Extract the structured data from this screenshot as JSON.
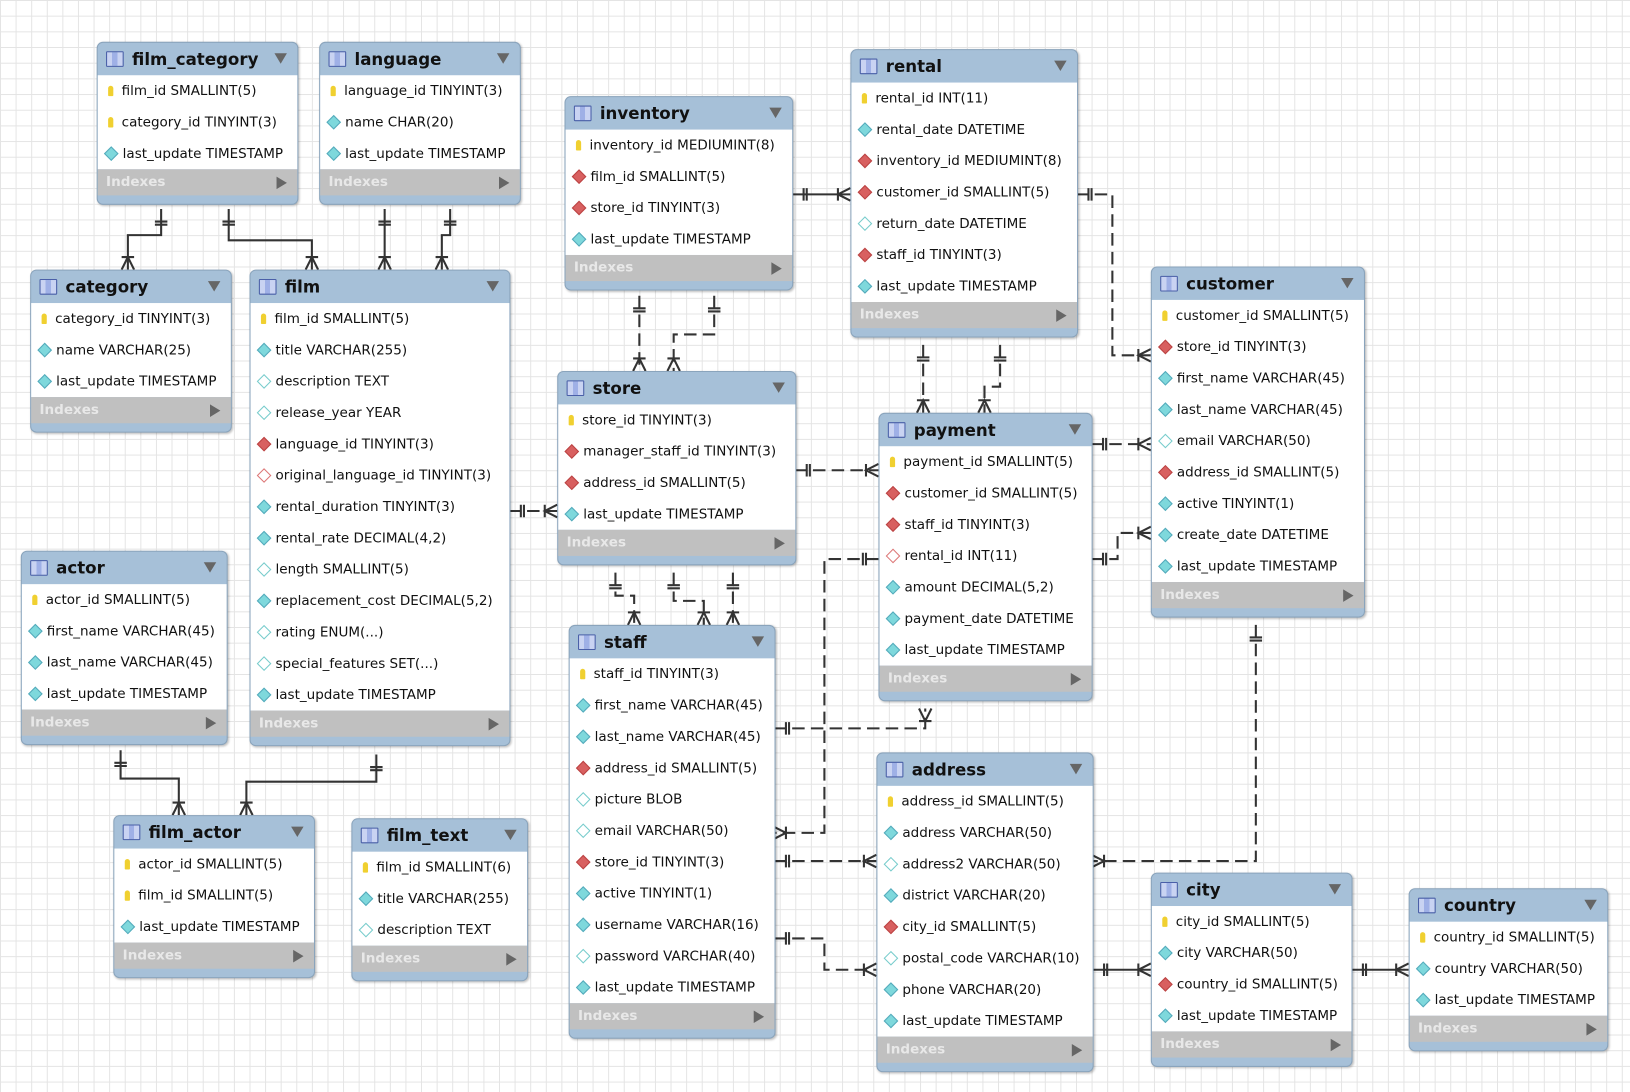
{
  "indexes_label": "Indexes",
  "colors": {
    "header": "#a6c0d8",
    "indexes": "#c0c0c0",
    "pk": "#f0d030",
    "not_null": "#7ed8dc",
    "foreign_key": "#d86060"
  },
  "tables": [
    {
      "name": "film_category",
      "columns": [
        [
          "film_id SMALLINT(5)",
          "pk"
        ],
        [
          "category_id TINYINT(3)",
          "pk"
        ],
        [
          "last_update TIMESTAMP",
          "nn"
        ]
      ]
    },
    {
      "name": "language",
      "columns": [
        [
          "language_id TINYINT(3)",
          "pk"
        ],
        [
          "name CHAR(20)",
          "nn"
        ],
        [
          "last_update TIMESTAMP",
          "nn"
        ]
      ]
    },
    {
      "name": "inventory",
      "columns": [
        [
          "inventory_id MEDIUMINT(8)",
          "pk"
        ],
        [
          "film_id SMALLINT(5)",
          "fk"
        ],
        [
          "store_id TINYINT(3)",
          "fk"
        ],
        [
          "last_update TIMESTAMP",
          "nn"
        ]
      ]
    },
    {
      "name": "rental",
      "columns": [
        [
          "rental_id INT(11)",
          "pk"
        ],
        [
          "rental_date DATETIME",
          "nn"
        ],
        [
          "inventory_id MEDIUMINT(8)",
          "fk"
        ],
        [
          "customer_id SMALLINT(5)",
          "fk"
        ],
        [
          "return_date DATETIME",
          "null"
        ],
        [
          "staff_id TINYINT(3)",
          "fk"
        ],
        [
          "last_update TIMESTAMP",
          "nn"
        ]
      ]
    },
    {
      "name": "category",
      "columns": [
        [
          "category_id TINYINT(3)",
          "pk"
        ],
        [
          "name VARCHAR(25)",
          "nn"
        ],
        [
          "last_update TIMESTAMP",
          "nn"
        ]
      ]
    },
    {
      "name": "film",
      "columns": [
        [
          "film_id SMALLINT(5)",
          "pk"
        ],
        [
          "title VARCHAR(255)",
          "nn"
        ],
        [
          "description TEXT",
          "null"
        ],
        [
          "release_year YEAR",
          "null"
        ],
        [
          "language_id TINYINT(3)",
          "fk"
        ],
        [
          "original_language_id TINYINT(3)",
          "fknull"
        ],
        [
          "rental_duration TINYINT(3)",
          "nn"
        ],
        [
          "rental_rate DECIMAL(4,2)",
          "nn"
        ],
        [
          "length SMALLINT(5)",
          "null"
        ],
        [
          "replacement_cost DECIMAL(5,2)",
          "nn"
        ],
        [
          "rating ENUM(...)",
          "null"
        ],
        [
          "special_features SET(...)",
          "null"
        ],
        [
          "last_update TIMESTAMP",
          "nn"
        ]
      ]
    },
    {
      "name": "store",
      "columns": [
        [
          "store_id TINYINT(3)",
          "pk"
        ],
        [
          "manager_staff_id TINYINT(3)",
          "fk"
        ],
        [
          "address_id SMALLINT(5)",
          "fk"
        ],
        [
          "last_update TIMESTAMP",
          "nn"
        ]
      ]
    },
    {
      "name": "customer",
      "columns": [
        [
          "customer_id SMALLINT(5)",
          "pk"
        ],
        [
          "store_id TINYINT(3)",
          "fk"
        ],
        [
          "first_name VARCHAR(45)",
          "nn"
        ],
        [
          "last_name VARCHAR(45)",
          "nn"
        ],
        [
          "email VARCHAR(50)",
          "null"
        ],
        [
          "address_id SMALLINT(5)",
          "fk"
        ],
        [
          "active TINYINT(1)",
          "nn"
        ],
        [
          "create_date DATETIME",
          "nn"
        ],
        [
          "last_update TIMESTAMP",
          "nn"
        ]
      ]
    },
    {
      "name": "payment",
      "columns": [
        [
          "payment_id SMALLINT(5)",
          "pk"
        ],
        [
          "customer_id SMALLINT(5)",
          "fk"
        ],
        [
          "staff_id TINYINT(3)",
          "fk"
        ],
        [
          "rental_id INT(11)",
          "fknull"
        ],
        [
          "amount DECIMAL(5,2)",
          "nn"
        ],
        [
          "payment_date DATETIME",
          "nn"
        ],
        [
          "last_update TIMESTAMP",
          "nn"
        ]
      ]
    },
    {
      "name": "actor",
      "columns": [
        [
          "actor_id SMALLINT(5)",
          "pk"
        ],
        [
          "first_name VARCHAR(45)",
          "nn"
        ],
        [
          "last_name VARCHAR(45)",
          "nn"
        ],
        [
          "last_update TIMESTAMP",
          "nn"
        ]
      ]
    },
    {
      "name": "staff",
      "columns": [
        [
          "staff_id TINYINT(3)",
          "pk"
        ],
        [
          "first_name VARCHAR(45)",
          "nn"
        ],
        [
          "last_name VARCHAR(45)",
          "nn"
        ],
        [
          "address_id SMALLINT(5)",
          "fk"
        ],
        [
          "picture BLOB",
          "null"
        ],
        [
          "email VARCHAR(50)",
          "null"
        ],
        [
          "store_id TINYINT(3)",
          "fk"
        ],
        [
          "active TINYINT(1)",
          "nn"
        ],
        [
          "username VARCHAR(16)",
          "nn"
        ],
        [
          "password VARCHAR(40)",
          "null"
        ],
        [
          "last_update TIMESTAMP",
          "nn"
        ]
      ]
    },
    {
      "name": "address",
      "columns": [
        [
          "address_id SMALLINT(5)",
          "pk"
        ],
        [
          "address VARCHAR(50)",
          "nn"
        ],
        [
          "address2 VARCHAR(50)",
          "null"
        ],
        [
          "district VARCHAR(20)",
          "nn"
        ],
        [
          "city_id SMALLINT(5)",
          "fk"
        ],
        [
          "postal_code VARCHAR(10)",
          "null"
        ],
        [
          "phone VARCHAR(20)",
          "nn"
        ],
        [
          "last_update TIMESTAMP",
          "nn"
        ]
      ]
    },
    {
      "name": "film_actor",
      "columns": [
        [
          "actor_id SMALLINT(5)",
          "pk"
        ],
        [
          "film_id SMALLINT(5)",
          "pk"
        ],
        [
          "last_update TIMESTAMP",
          "nn"
        ]
      ]
    },
    {
      "name": "film_text",
      "columns": [
        [
          "film_id SMALLINT(6)",
          "pk"
        ],
        [
          "title VARCHAR(255)",
          "nn"
        ],
        [
          "description TEXT",
          "null"
        ]
      ]
    },
    {
      "name": "city",
      "columns": [
        [
          "city_id SMALLINT(5)",
          "pk"
        ],
        [
          "city VARCHAR(50)",
          "nn"
        ],
        [
          "country_id SMALLINT(5)",
          "fk"
        ],
        [
          "last_update TIMESTAMP",
          "nn"
        ]
      ]
    },
    {
      "name": "country",
      "columns": [
        [
          "country_id SMALLINT(5)",
          "pk"
        ],
        [
          "country VARCHAR(50)",
          "nn"
        ],
        [
          "last_update TIMESTAMP",
          "nn"
        ]
      ]
    }
  ]
}
